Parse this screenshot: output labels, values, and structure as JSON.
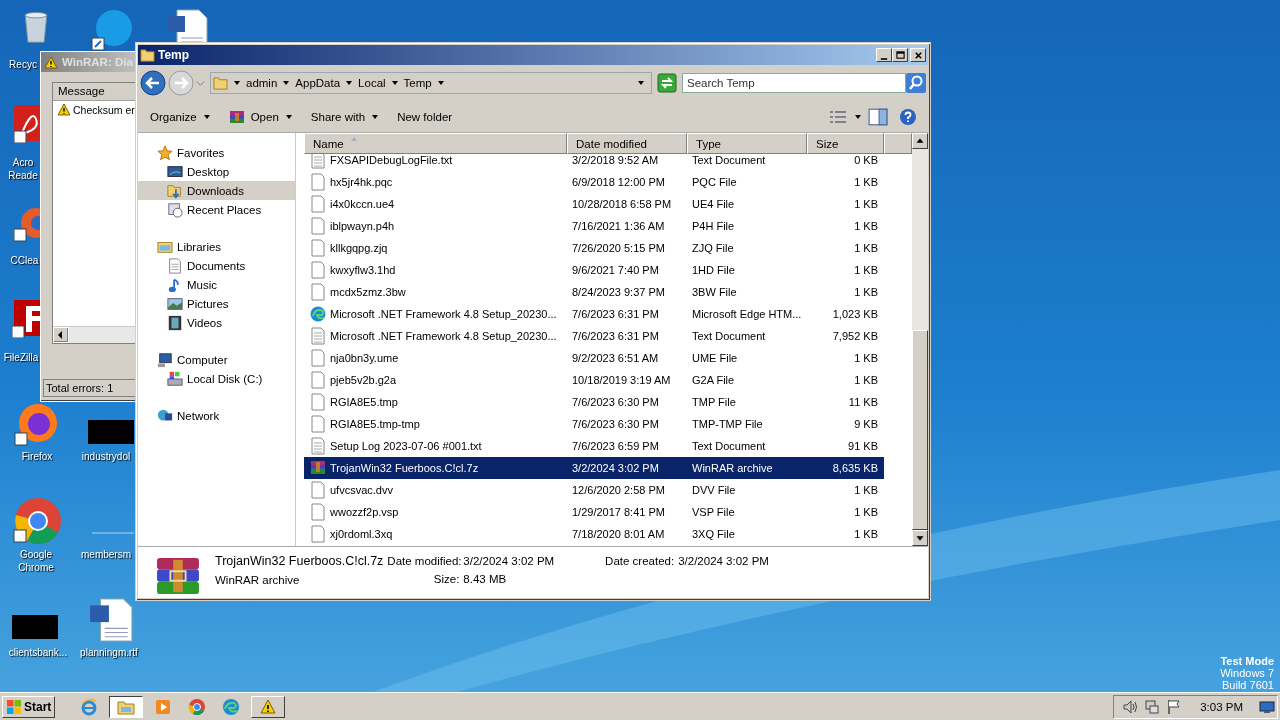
{
  "desktop": {
    "icons": [
      {
        "kind": "recycle-bin",
        "label": "Recyc"
      },
      {
        "kind": "skype"
      },
      {
        "kind": "word"
      },
      {
        "kind": "acrobat",
        "label": "Acro\nReade"
      },
      {
        "kind": "ccleaner",
        "label": "CClea"
      },
      {
        "kind": "filezilla",
        "label": "FileZilla"
      },
      {
        "kind": "firefox",
        "label": "Firefox"
      },
      {
        "kind": "redacted",
        "label": "industrydol"
      },
      {
        "kind": "chrome",
        "label": "Google\nChrome"
      },
      {
        "kind": "blank",
        "label": "membersm"
      },
      {
        "kind": "redacted",
        "label": "clientsbank..."
      },
      {
        "kind": "word",
        "label": "planningm.rtf"
      }
    ],
    "system_text": [
      "Test Mode",
      "Windows 7",
      "Build 7601"
    ]
  },
  "diagnostic_window": {
    "title": "WinRAR: Dia",
    "column": "Message",
    "messages": [
      "Checksum er"
    ],
    "status": "Total errors: 1"
  },
  "explorer": {
    "title": "Temp",
    "breadcrumb": [
      "admin",
      "AppData",
      "Local",
      "Temp"
    ],
    "search": {
      "placeholder": "Search Temp"
    },
    "toolbar": [
      {
        "label": "Organize",
        "kind": "menu"
      },
      {
        "label": "Open",
        "kind": "open"
      },
      {
        "label": "Share with",
        "kind": "menu"
      },
      {
        "label": "New folder",
        "kind": "plain"
      }
    ],
    "nav": [
      {
        "label": "Favorites",
        "kind": "favorites",
        "selected": false,
        "children": [
          {
            "label": "Desktop",
            "kind": "desktop",
            "selected": false
          },
          {
            "label": "Downloads",
            "kind": "downloads",
            "selected": true
          },
          {
            "label": "Recent Places",
            "kind": "recent",
            "selected": false
          }
        ]
      },
      {
        "label": "Libraries",
        "kind": "libraries",
        "selected": false,
        "children": [
          {
            "label": "Documents",
            "kind": "documents",
            "selected": false
          },
          {
            "label": "Music",
            "kind": "music",
            "selected": false
          },
          {
            "label": "Pictures",
            "kind": "pictures",
            "selected": false
          },
          {
            "label": "Videos",
            "kind": "videos",
            "selected": false
          }
        ]
      },
      {
        "label": "Computer",
        "kind": "computer",
        "selected": false,
        "children": [
          {
            "label": "Local Disk (C:)",
            "kind": "disk",
            "selected": false
          }
        ]
      },
      {
        "label": "Network",
        "kind": "network",
        "selected": false
      }
    ],
    "columns": [
      "Name",
      "Date modified",
      "Type",
      "Size"
    ],
    "rows": [
      {
        "kind": "text",
        "name": "FXSAPIDebugLogFile.txt",
        "date": "3/2/2018 9:52 AM",
        "type": "Text Document",
        "size": "0 KB",
        "selected": false
      },
      {
        "kind": "blank",
        "name": "hx5jr4hk.pqc",
        "date": "6/9/2018 12:00 PM",
        "type": "PQC File",
        "size": "1 KB",
        "selected": false
      },
      {
        "kind": "blank",
        "name": "i4x0kccn.ue4",
        "date": "10/28/2018 6:58 PM",
        "type": "UE4 File",
        "size": "1 KB",
        "selected": false
      },
      {
        "kind": "blank",
        "name": "iblpwayn.p4h",
        "date": "7/16/2021 1:36 AM",
        "type": "P4H File",
        "size": "1 KB",
        "selected": false
      },
      {
        "kind": "blank",
        "name": "kllkgqpg.zjq",
        "date": "7/26/2020 5:15 PM",
        "type": "ZJQ File",
        "size": "1 KB",
        "selected": false
      },
      {
        "kind": "blank",
        "name": "kwxyflw3.1hd",
        "date": "9/6/2021 7:40 PM",
        "type": "1HD File",
        "size": "1 KB",
        "selected": false
      },
      {
        "kind": "blank",
        "name": "mcdx5zmz.3bw",
        "date": "8/24/2023 9:37 PM",
        "type": "3BW File",
        "size": "1 KB",
        "selected": false
      },
      {
        "kind": "edge",
        "name": "Microsoft .NET Framework 4.8 Setup_20230...",
        "date": "7/6/2023 6:31 PM",
        "type": "Microsoft Edge HTM...",
        "size": "1,023 KB",
        "selected": false
      },
      {
        "kind": "text",
        "name": "Microsoft .NET Framework 4.8 Setup_20230...",
        "date": "7/6/2023 6:31 PM",
        "type": "Text Document",
        "size": "7,952 KB",
        "selected": false
      },
      {
        "kind": "blank",
        "name": "nja0bn3y.ume",
        "date": "9/2/2023 6:51 AM",
        "type": "UME File",
        "size": "1 KB",
        "selected": false
      },
      {
        "kind": "blank",
        "name": "pjeb5v2b.g2a",
        "date": "10/18/2019 3:19 AM",
        "type": "G2A File",
        "size": "1 KB",
        "selected": false
      },
      {
        "kind": "blank",
        "name": "RGIA8E5.tmp",
        "date": "7/6/2023 6:30 PM",
        "type": "TMP File",
        "size": "11 KB",
        "selected": false
      },
      {
        "kind": "blank",
        "name": "RGIA8E5.tmp-tmp",
        "date": "7/6/2023 6:30 PM",
        "type": "TMP-TMP File",
        "size": "9 KB",
        "selected": false
      },
      {
        "kind": "text",
        "name": "Setup Log 2023-07-06 #001.txt",
        "date": "7/6/2023 6:59 PM",
        "type": "Text Document",
        "size": "91 KB",
        "selected": false
      },
      {
        "kind": "winrar",
        "name": "TrojanWin32 Fuerboos.C!cl.7z",
        "date": "3/2/2024 3:02 PM",
        "type": "WinRAR archive",
        "size": "8,635 KB",
        "selected": true
      },
      {
        "kind": "blank",
        "name": "ufvcsvac.dvv",
        "date": "12/6/2020 2:58 PM",
        "type": "DVV File",
        "size": "1 KB",
        "selected": false
      },
      {
        "kind": "blank",
        "name": "wwozzf2p.vsp",
        "date": "1/29/2017 8:41 PM",
        "type": "VSP File",
        "size": "1 KB",
        "selected": false
      },
      {
        "kind": "blank",
        "name": "xj0rdoml.3xq",
        "date": "7/18/2020 8:01 AM",
        "type": "3XQ File",
        "size": "1 KB",
        "selected": false
      }
    ],
    "details": {
      "name": "TrojanWin32 Fuerboos.C!cl.7z",
      "type": "WinRAR archive",
      "date_modified": {
        "label": "Date modified:",
        "value": "3/2/2024 3:02 PM"
      },
      "size": {
        "label": "Size:",
        "value": "8.43 MB"
      },
      "date_created": {
        "label": "Date created:",
        "value": "3/2/2024 3:02 PM"
      }
    }
  },
  "taskbar": {
    "start": "Start",
    "apps": [
      {
        "kind": "ie",
        "running": false,
        "selected": false
      },
      {
        "kind": "explorer",
        "running": true,
        "selected": true
      },
      {
        "kind": "media",
        "running": false,
        "selected": false
      },
      {
        "kind": "chrome",
        "running": false,
        "selected": false
      },
      {
        "kind": "edge",
        "running": false,
        "selected": false
      },
      {
        "kind": "warning",
        "running": true,
        "selected": false
      }
    ],
    "clock": "3:03 PM"
  }
}
